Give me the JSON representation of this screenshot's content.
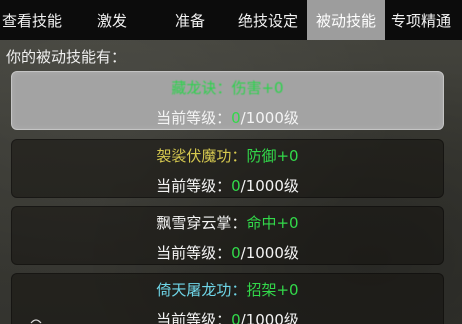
{
  "tabs": [
    {
      "label": "查看技能"
    },
    {
      "label": "激发"
    },
    {
      "label": "准备"
    },
    {
      "label": "绝技设定"
    },
    {
      "label": "被动技能"
    },
    {
      "label": "专项精通"
    }
  ],
  "section_title": "你的被动技能有：",
  "skills": [
    {
      "name": "藏龙诀",
      "stat": "伤害+0",
      "name_color": "#2bd34b",
      "level_label": "当前等级：",
      "level_value": "0",
      "level_max": "/1000级"
    },
    {
      "name": "袈裟伏魔功",
      "stat": "防御+0",
      "name_color": "#d6c94f",
      "level_label": "当前等级：",
      "level_value": "0",
      "level_max": "/1000级"
    },
    {
      "name": "飘雪穿云掌",
      "stat": "命中+0",
      "name_color": "#f4f4f4",
      "level_label": "当前等级：",
      "level_value": "0",
      "level_max": "/1000级"
    },
    {
      "name": "倚天屠龙功",
      "stat": "招架+0",
      "name_color": "#6fd6e8",
      "level_label": "当前等级：",
      "level_value": "0",
      "level_max": "/1000级"
    }
  ],
  "colors": {
    "stat": "#32d94a",
    "level_value": "#32d94a",
    "selected_tab": "#9d9d9d"
  }
}
